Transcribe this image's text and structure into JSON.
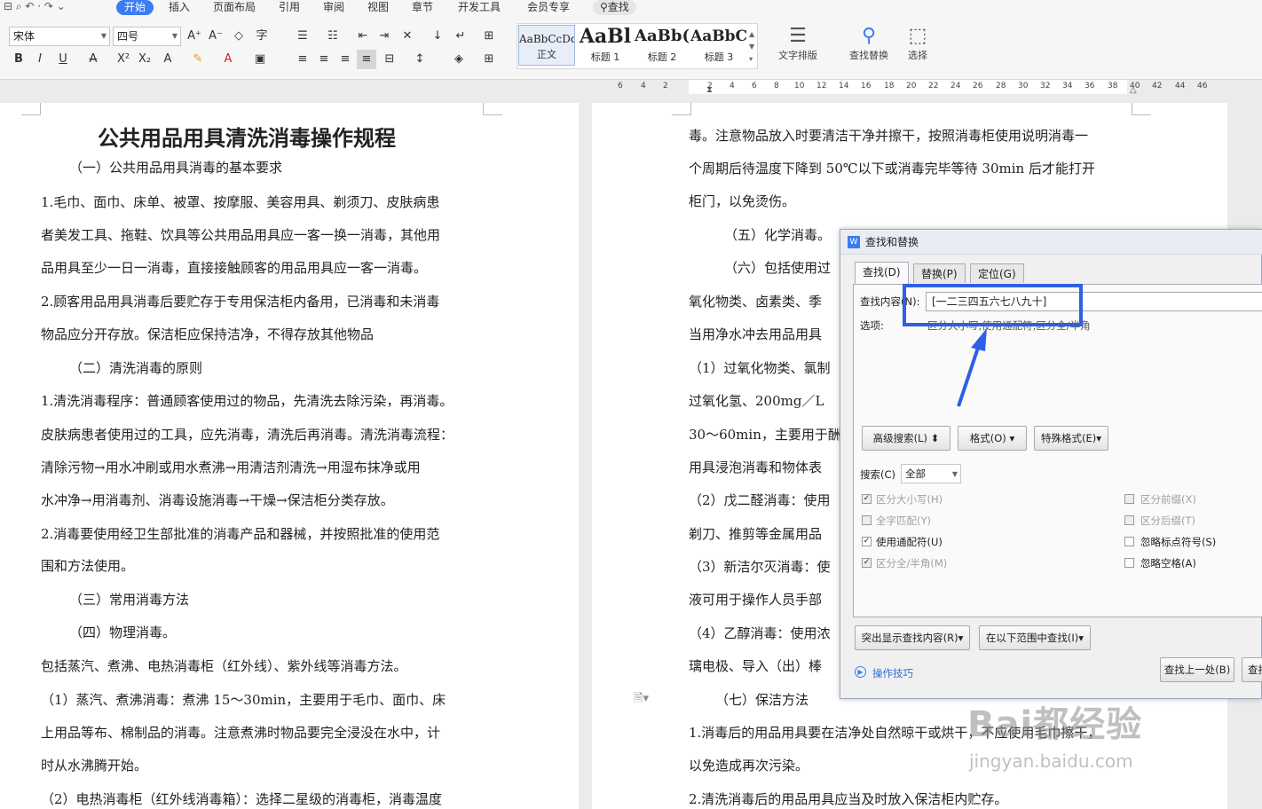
{
  "menu": {
    "tabs": [
      "开始",
      "插入",
      "页面布局",
      "引用",
      "审阅",
      "视图",
      "章节",
      "开发工具",
      "会员专享"
    ],
    "search": "查找"
  },
  "ribbon": {
    "font_name": "宋体",
    "font_size": "四号",
    "styles": [
      {
        "preview": "AaBbCcDd",
        "label": "正文"
      },
      {
        "preview": "AaBl",
        "label": "标题 1"
      },
      {
        "preview": "AaBb(",
        "label": "标题 2"
      },
      {
        "preview": "AaBbC",
        "label": "标题 3"
      }
    ],
    "text_layout": "文字排版",
    "find_replace": "查找替换",
    "select": "选择"
  },
  "ruler": {
    "left": [
      "6",
      "4",
      "2"
    ],
    "right": [
      "2",
      "4",
      "6",
      "8",
      "10",
      "12",
      "14",
      "16",
      "18",
      "20",
      "22",
      "24",
      "26",
      "28",
      "30",
      "32",
      "34",
      "36",
      "38",
      "40",
      "42",
      "44",
      "46"
    ]
  },
  "page1": {
    "title": "公共用品用具清洗消毒操作规程",
    "lines": [
      "（一）公共用品用具消毒的基本要求",
      "1.毛巾、面巾、床单、被罩、按摩服、美容用具、剃须刀、皮肤病患",
      "者美发工具、拖鞋、饮具等公共用品用具应一客一换一消毒，其他用",
      "品用具至少一日一消毒，直接接触顾客的用品用具应一客一消毒。",
      "2.顾客用品用具消毒后要贮存于专用保洁柜内备用，已消毒和未消毒",
      "物品应分开存放。保洁柜应保持洁净，不得存放其他物品",
      "（二）清洗消毒的原则",
      "1.清洗消毒程序：普通顾客使用过的物品，先清洗去除污染，再消毒。",
      "皮肤病患者使用过的工具，应先消毒，清洗后再消毒。清洗消毒流程：",
      "清除污物→用水冲刷或用水煮沸→用清洁剂清洗→用湿布抹净或用",
      "水冲净→用消毒剂、消毒设施消毒→干燥→保洁柜分类存放。",
      "2.消毒要使用经卫生部批准的消毒产品和器械，并按照批准的使用范",
      "围和方法使用。",
      "（三）常用消毒方法",
      "（四）物理消毒。",
      "包括蒸汽、煮沸、电热消毒柜（红外线）、紫外线等消毒方法。",
      "（1）蒸汽、煮沸消毒：煮沸 15～30min，主要用于毛巾、面巾、床",
      "上用品等布、棉制品的消毒。注意煮沸时物品要完全浸没在水中，计",
      "时从水沸腾开始。",
      "（2）电热消毒柜（红外线消毒箱）：选择二星级的消毒柜，消毒温度"
    ]
  },
  "page2": {
    "lines": [
      "毒。注意物品放入时要清洁干净并擦干，按照消毒柜使用说明消毒一",
      "个周期后待温度下降到 50℃以下或消毒完毕等待 30min 后才能打开",
      "柜门，以免烫伤。",
      "（五）化学消毒。",
      "（六）包括使用过",
      "氧化物类、卤素类、季",
      "当用净水冲去用品用具",
      "（1）过氧化物类、氯制",
      "过氧化氢、200mg／L",
      "30～60min，主要用于酬",
      "用具浸泡消毒和物体表",
      "（2）戊二醛消毒：使用",
      "剃刀、推剪等金属用品",
      "（3）新洁尔灭消毒：使",
      "液可用于操作人员手部",
      "（4）乙醇消毒：使用浓",
      "璃电极、导入（出）棒",
      "（七）保洁方法",
      "1.消毒后的用品用具要在洁净处自然晾干或烘干，不应使用毛巾擦干，",
      "以免造成再次污染。",
      "2.清洗消毒后的用品用具应当及时放入保洁柜内贮存。"
    ]
  },
  "dialog": {
    "title": "查找和替换",
    "tabs": [
      "查找(D)",
      "替换(P)",
      "定位(G)"
    ],
    "find_label": "查找内容(N):",
    "find_value": "[一二三四五六七八九十]",
    "options_label": "选项:",
    "options_value": "区分大小写,使用通配符,区分全/半角",
    "advanced_btn": "高级搜索(L)",
    "format_btn": "格式(O)",
    "special_btn": "特殊格式(E)",
    "search_label": "搜索(C)",
    "search_value": "全部",
    "checks_left": [
      {
        "label": "区分大小写(H)",
        "checked": true,
        "disabled": true
      },
      {
        "label": "全字匹配(Y)",
        "checked": false,
        "disabled": true
      },
      {
        "label": "使用通配符(U)",
        "checked": true,
        "disabled": false
      },
      {
        "label": "区分全/半角(M)",
        "checked": true,
        "disabled": true
      }
    ],
    "checks_right": [
      {
        "label": "区分前缀(X)",
        "checked": false,
        "disabled": true
      },
      {
        "label": "区分后缀(T)",
        "checked": false,
        "disabled": true
      },
      {
        "label": "忽略标点符号(S)",
        "checked": false,
        "disabled": false
      },
      {
        "label": "忽略空格(A)",
        "checked": false,
        "disabled": false
      }
    ],
    "highlight_btn": "突出显示查找内容(R)",
    "range_btn": "在以下范围中查找(I)",
    "tips": "操作技巧",
    "find_prev": "查找上一处(B)",
    "find_next": "查找"
  },
  "watermark": {
    "logo": "Bai都经验",
    "url": "jingyan.baidu.com"
  },
  "colors": {
    "accent": "#3b7cf2",
    "highlight_box": "#2f5fe6",
    "arrow": "#2f5fe6"
  }
}
